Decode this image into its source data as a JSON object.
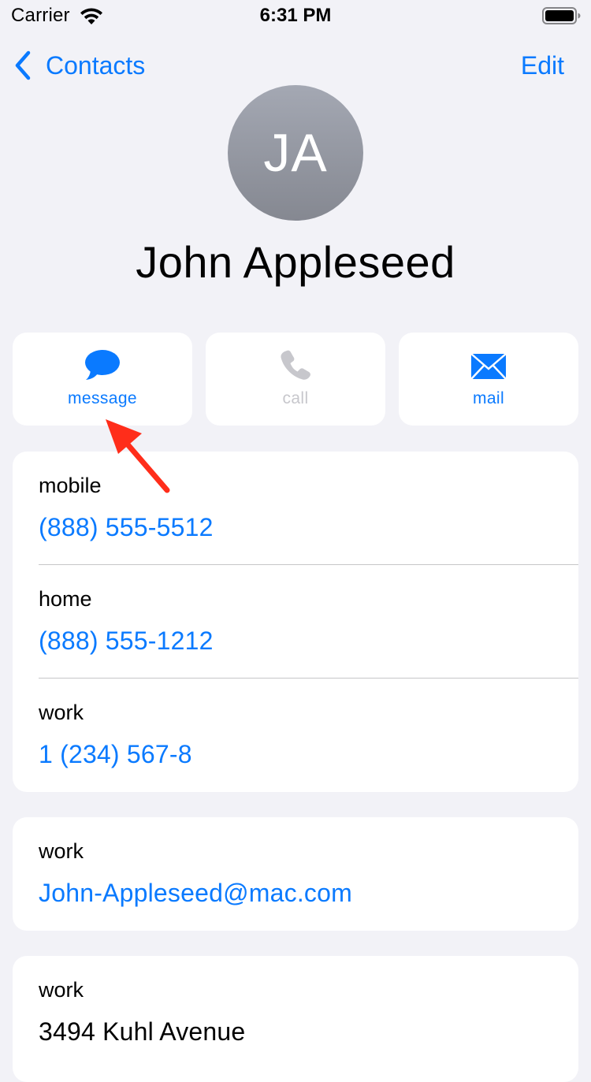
{
  "status_bar": {
    "carrier": "Carrier",
    "time": "6:31 PM"
  },
  "nav": {
    "back_label": "Contacts",
    "edit_label": "Edit"
  },
  "contact": {
    "initials": "JA",
    "name": "John Appleseed"
  },
  "actions": [
    {
      "label": "message",
      "icon": "message-bubble-icon",
      "enabled": true
    },
    {
      "label": "call",
      "icon": "phone-icon",
      "enabled": false
    },
    {
      "label": "mail",
      "icon": "envelope-icon",
      "enabled": true
    }
  ],
  "phones": [
    {
      "label": "mobile",
      "value": "(888) 555-5512"
    },
    {
      "label": "home",
      "value": "(888) 555-1212"
    },
    {
      "label": "work",
      "value": "1 (234) 567-8"
    }
  ],
  "email": {
    "label": "work",
    "value": "John-Appleseed@mac.com"
  },
  "address": {
    "label": "work",
    "line1": "3494 Kuhl Avenue"
  },
  "colors": {
    "accent": "#0A7AFF",
    "background": "#F2F2F7",
    "disabled": "#C7C7CC",
    "annotation": "#FF2D1A"
  }
}
